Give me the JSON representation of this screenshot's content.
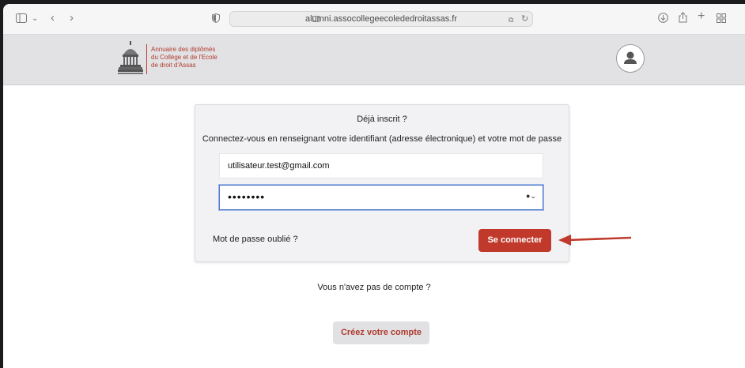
{
  "browser": {
    "url": "alumni.assocollegeecolededroitassas.fr",
    "icons": {
      "sidebar": "sidebar-icon",
      "back": "chevron-left-icon",
      "forward": "chevron-right-icon",
      "privacy": "shield-icon",
      "translate": "translate-icon",
      "reload": "reload-icon",
      "download": "download-icon",
      "share": "share-icon",
      "new_tab": "plus-icon",
      "tabs": "tab-overview-icon"
    }
  },
  "site": {
    "logo_text": "Annuaire des diplômés\ndu Collège et de l'Ecole\nde droit d'Assas",
    "brand_color": "#c0392b"
  },
  "login": {
    "title": "Déjà inscrit ?",
    "subtitle": "Connectez-vous en renseignant votre identifiant (adresse électronique) et votre mot de passe",
    "email_value": "utilisateur.test@gmail.com",
    "password_mask": "••••••••",
    "forgot_label": "Mot de passe oublié ?",
    "submit_label": "Se connecter"
  },
  "signup": {
    "prompt": "Vous n'avez pas de compte ?",
    "button_label": "Créez votre compte"
  }
}
